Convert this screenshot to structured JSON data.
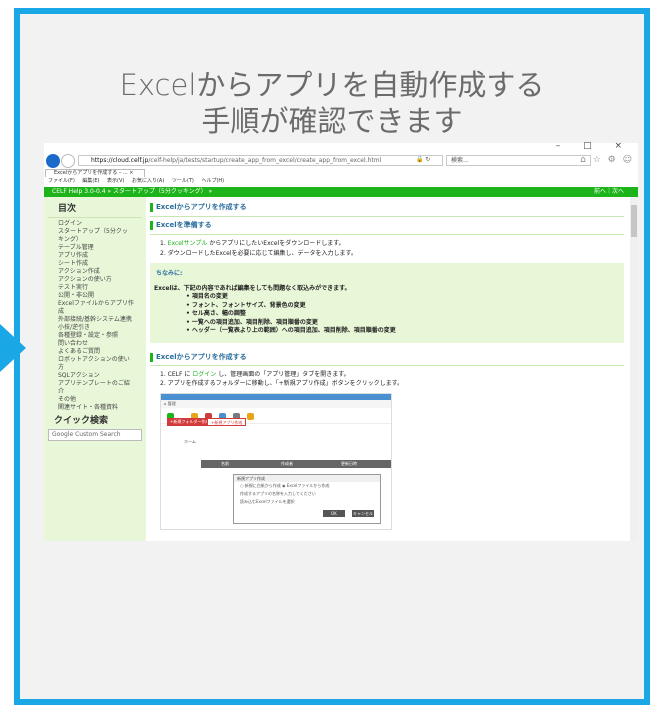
{
  "headline": [
    "Excelからアプリを自動作成する",
    "手順が確認できます"
  ],
  "browser": {
    "window_controls": "– □ ×",
    "url_host": "https://cloud.celf.jp",
    "url_path": "/celf-help/ja/tests/startup/create_app_from_excel/create_app_from_excel.html",
    "search_placeholder": "検索...",
    "tab_title": "Excelからアプリを作成する – ... ×",
    "menu": [
      "ファイル(F)",
      "編集(E)",
      "表示(V)",
      "お気に入り(A)",
      "ツール(T)",
      "ヘルプ(H)"
    ],
    "icons": [
      "back-icon",
      "forward-icon",
      "refresh-icon",
      "lock-icon",
      "search-icon",
      "home-icon",
      "star-icon",
      "gear-icon",
      "smiley-icon"
    ]
  },
  "help": {
    "breadcrumb": "CELF Help 3.0-0.4 » スタートアップ（5分クッキング） »",
    "nav_right": "前へ｜次へ",
    "sidebar_title": "目次",
    "sidebar_items": [
      "ログイン",
      "スタートアップ（5分クッ",
      "キング）",
      "テーブル管理",
      "アプリ作成",
      "シート作成",
      "アクション作成",
      "アクションの使い方",
      "テスト実行",
      "公開・非公開",
      "Excelファイルからアプリ作",
      "成",
      "外部接続/基幹システム連携",
      "小技/逆引き",
      "各種登録・設定・参照",
      "問い合わせ",
      "よくあるご質問",
      "ロボットアクションの使い",
      "方",
      "SQLアクション",
      "アプリテンプレートのご紹",
      "介",
      "その他",
      "関連サイト・各種資料"
    ],
    "quick_search": "クイック検索",
    "google_search": "Google Custom Search",
    "page_title": "Excelからアプリを作成する",
    "section1": "Excelを準備する",
    "step1_num": "1.",
    "step1_link": "Excelサンプル",
    "step1_text": "からアプリにしたいExcelをダウンロードします。",
    "step2": "2. ダウンロードしたExcelを必要に応じて編集し、データを入力します。",
    "note_title": "ちなみに:",
    "note_body": "Excelは、下記の内容であれば編集をしても問題なく取込みができます。",
    "note_items": [
      "• 項目名の変更",
      "• フォント、フォントサイズ、背景色の変更",
      "• セル高さ、幅の調整",
      "• 一覧への項目追加、項目削除、項目順番の変更",
      "• ヘッダー（一覧表より上の範囲）への項目追加、項目削除、項目順番の変更"
    ],
    "section2": "Excelからアプリを作成する",
    "step3_prefix": "1. CELF に",
    "step3_link": "ログイン",
    "step3_suffix": "し、管理画面の「アプリ管理」タブを開きます。",
    "step4": "2. アプリを作成するフォルダーに移動し、「+新規アプリ作成」ボタンをクリックします。"
  },
  "inner": {
    "bar_title": "CELF",
    "breadcrumb": "⌂ 管理",
    "btn_new_folder": "+新規フォルダー作成",
    "btn_new_app": "+新規アプリ作成",
    "path": "ホーム",
    "tbl_cols": [
      "名前",
      "作成者",
      "更新日時"
    ],
    "modal_title": "新規アプリ作成",
    "modal_opt1": "○ 新規に白紙から作成",
    "modal_opt2": "◉ Excelファイルから作成",
    "modal_row1": "作成するアプリの名称を入力してください",
    "modal_row2": "読み込むExcelファイルを選択",
    "modal_ok": "OK",
    "modal_cancel": "キャンセル"
  },
  "colors": {
    "frame": "#1aa7e6",
    "green": "#1db31a",
    "sidebar_bg": "#e9f7d9",
    "heading_blue": "#2b6e9e"
  }
}
